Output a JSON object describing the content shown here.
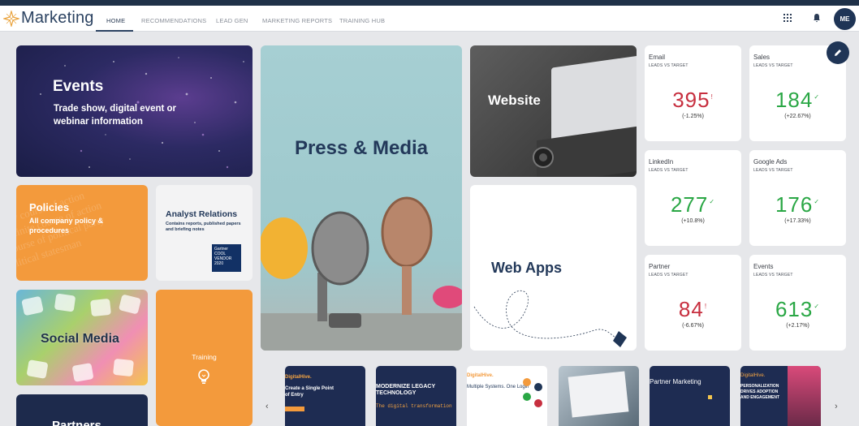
{
  "app": {
    "title": "Marketing"
  },
  "nav": {
    "tabs": [
      {
        "label": "HOME",
        "active": true
      },
      {
        "label": "RECOMMENDATIONS"
      },
      {
        "label": "LEAD GEN"
      },
      {
        "label": "MARKETING REPORTS"
      },
      {
        "label": "TRAINING HUB"
      }
    ]
  },
  "header_icons": [
    "grid-icon",
    "bell-icon"
  ],
  "user": {
    "initials": "ME"
  },
  "tiles": {
    "events": {
      "title": "Events",
      "subtitle": "Trade show, digital event or webinar information"
    },
    "policies": {
      "title": "Policies",
      "subtitle": "All company policy & procedures"
    },
    "analyst": {
      "title": "Analyst Relations",
      "subtitle": "Contains reports, published papers and briefing notes",
      "badge": "Gartner COOL VENDOR 2020"
    },
    "social": {
      "title": "Social Media"
    },
    "training": {
      "title": "Training"
    },
    "partners": {
      "title": "Partners"
    },
    "press": {
      "title": "Press & Media"
    },
    "website": {
      "title": "Website"
    },
    "webapps": {
      "title": "Web Apps"
    }
  },
  "kpis": [
    {
      "name": "Email",
      "label": "LEADS VS TARGET",
      "value": "395",
      "mark": "!",
      "delta": "(-1.25%)",
      "trend": "down"
    },
    {
      "name": "Sales",
      "label": "LEADS VS TARGET",
      "value": "184",
      "mark": "✓",
      "delta": "(+22.67%)",
      "trend": "up"
    },
    {
      "name": "LinkedIn",
      "label": "LEADS VS TARGET",
      "value": "277",
      "mark": "✓",
      "delta": "(+10.8%)",
      "trend": "up"
    },
    {
      "name": "Google Ads",
      "label": "LEADS VS TARGET",
      "value": "176",
      "mark": "✓",
      "delta": "(+17.33%)",
      "trend": "up"
    },
    {
      "name": "Partner",
      "label": "LEADS VS TARGET",
      "value": "84",
      "mark": "!",
      "delta": "(-6.67%)",
      "trend": "down"
    },
    {
      "name": "Events",
      "label": "LEADS VS TARGET",
      "value": "613",
      "mark": "✓",
      "delta": "(+2.17%)",
      "trend": "up"
    }
  ],
  "carousel": {
    "prev_icon": "chevron-left-icon",
    "next_icon": "chevron-right-icon",
    "cards": [
      {
        "text": "Create a Single Point of Entry",
        "brand": "DigitalHive."
      },
      {
        "text": "MODERNIZE LEGACY TECHNOLOGY",
        "sub": "The digital transformation"
      },
      {
        "text": "Multiple Systems. One Login",
        "brand": "DigitalHive."
      },
      {
        "text": ""
      },
      {
        "text": "Partner Marketing"
      },
      {
        "text": "PERSONALIZATION DRIVES ADOPTION AND ENGAGEMENT",
        "brand": "DigitalHive."
      }
    ]
  },
  "colors": {
    "navy": "#1f3556",
    "orange": "#f39a3c",
    "negative": "#c72f3f",
    "positive": "#2aa745"
  }
}
